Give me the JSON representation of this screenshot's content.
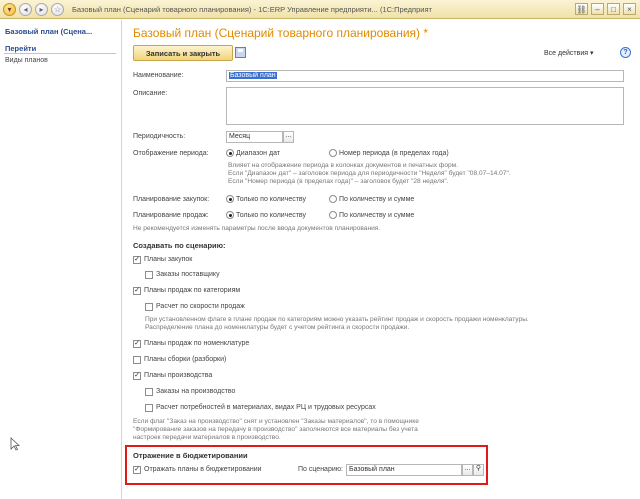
{
  "window": {
    "title": "Базовый план (Сценарий товарного планирования) - 1С:ERP Управление предприяти... (1С:Предприятие)"
  },
  "sidebar": {
    "title": "Базовый план (Сцена...",
    "goto": "Перейти",
    "links": [
      "Виды планов"
    ]
  },
  "form": {
    "title": "Базовый план (Сценарий товарного планирования) *",
    "save_close": "Записать и закрыть",
    "all_actions": "Все действия",
    "help": "?",
    "name_label": "Наименование:",
    "name_value": "Базовый план",
    "description_label": "Описание:",
    "periodicity_label": "Периодичность:",
    "periodicity_value": "Месяц",
    "display_label": "Отображение периода:",
    "display_opt1": "Диапазон дат",
    "display_opt2": "Номер периода (в пределах года)",
    "display_note1": "Влияет на отображение периода в колонках документов и печатных форм.",
    "display_note2": "Если \"Диапазон дат\" – заголовок периода для периодичности \"Неделя\" будет \"08.07–14.07\".",
    "display_note3": "Если \"Номер периода (в пределах года)\" – заголовок будет \"28 неделя\".",
    "purchase_label": "Планирование закупок:",
    "purchase_opt1": "Только по количеству",
    "purchase_opt2": "По количеству и сумме",
    "sales_label": "Планирование продаж:",
    "sales_opt1": "Только по количеству",
    "sales_opt2": "По количеству и сумме",
    "plan_note": "Не рекомендуется изменять параметры после ввода документов планирования.",
    "create_header": "Создавать по сценарию:",
    "cb_purchase_plans": "Планы закупок",
    "cb_supplier_orders": "Заказы поставщику",
    "cb_category_sales": "Планы продаж по категориям",
    "cb_sales_speed": "Расчет по скорости продаж",
    "category_note1": "При установленном флаге в плане продаж по категориям можно указать рейтинг продаж и скорость продажи номенклатуры.",
    "category_note2": "Распределение плана до номенклатуры будет с учетом рейтинга и скорости продажи.",
    "cb_item_sales": "Планы продаж по номенклатуре",
    "cb_assembly": "Планы сборки (разборки)",
    "cb_production": "Планы производства",
    "cb_production_orders": "Заказы на производство",
    "cb_material_calc": "Расчет потребностей в материалах, видах РЦ и трудовых ресурсах",
    "production_note1": "Если флаг \"Заказ на производство\" снят и установлен \"Заказы материалов\", то в помощнике",
    "production_note2": "\"Формирование заказов на передачу в производство\" заполняются все материалы без учета",
    "production_note3": "настроек передачи материалов в производство.",
    "budget_header": "Отражение в бюджетировании",
    "cb_budget": "Отражать планы в бюджетировании",
    "scenario_label": "По сценарию:",
    "scenario_value": "Базовый план"
  },
  "state": {
    "display": "range",
    "purchase": "qty",
    "sales": "qty",
    "checks": {
      "purchase_plans": true,
      "supplier_orders": false,
      "category_sales": true,
      "sales_speed": false,
      "item_sales": true,
      "assembly": false,
      "production": true,
      "production_orders": false,
      "material_calc": false,
      "budget": true
    }
  },
  "icons": {
    "minimize": "minimize-icon",
    "back": "back-icon",
    "forward": "forward-icon",
    "save": "disk-icon",
    "search": "search-icon"
  },
  "colors": {
    "title_orange": "#e08a00",
    "sidebar_blue": "#2a4b8d",
    "highlight_red": "#e01919",
    "selection_blue": "#3a6fd3"
  }
}
